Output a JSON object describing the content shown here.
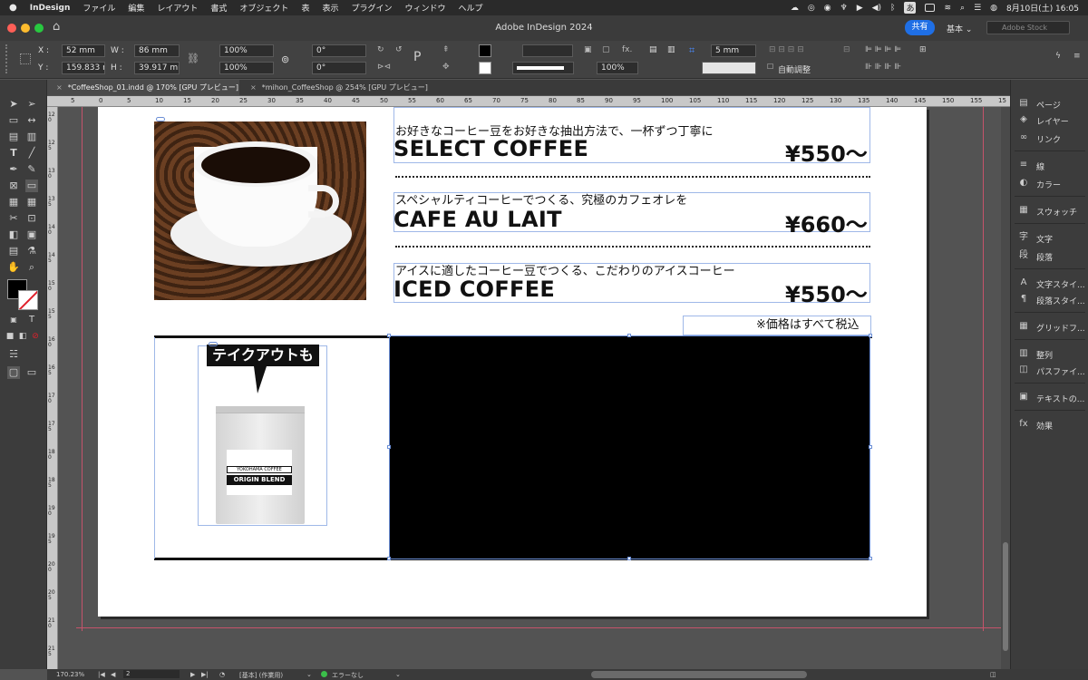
{
  "menubar": {
    "app_name": "InDesign",
    "items": [
      "ファイル",
      "編集",
      "レイアウト",
      "書式",
      "オブジェクト",
      "表",
      "表示",
      "プラグイン",
      "ウィンドウ",
      "ヘルプ"
    ],
    "input_mode": "あ",
    "datetime": "8月10日(土)  16:05"
  },
  "titlebar": {
    "title": "Adobe InDesign 2024",
    "share_label": "共有",
    "workspace": "基本",
    "stock_placeholder": "Adobe Stock"
  },
  "control": {
    "x_label": "X :",
    "x_value": "52 mm",
    "y_label": "Y :",
    "y_value": "159.833 m",
    "w_label": "W :",
    "w_value": "86 mm",
    "h_label": "H :",
    "h_value": "39.917 mm",
    "scale_x": "100%",
    "scale_y": "100%",
    "rotate": "0°",
    "shear": "0°",
    "stroke_weight": "",
    "opacity": "100%",
    "gap": "5 mm",
    "auto_fit_label": "自動調整"
  },
  "tabs": [
    {
      "label": "*CoffeeShop_01.indd @ 170% [GPU プレビュー]",
      "active": true
    },
    {
      "label": "*mihon_CoffeeShop @ 254% [GPU プレビュー]",
      "active": false
    }
  ],
  "ruler": {
    "h_ticks": [
      "5",
      "0",
      "5",
      "10",
      "15",
      "20",
      "25",
      "30",
      "35",
      "40",
      "45",
      "50",
      "55",
      "60",
      "65",
      "70",
      "75",
      "80",
      "85",
      "90",
      "95",
      "100",
      "105",
      "110",
      "115",
      "120",
      "125",
      "130",
      "135",
      "140",
      "145",
      "150",
      "155",
      "15"
    ],
    "v_ticks": [
      "120",
      "125",
      "130",
      "135",
      "140",
      "145",
      "150",
      "155",
      "160",
      "165",
      "170",
      "175",
      "180",
      "185",
      "190",
      "195",
      "200",
      "205",
      "210",
      "215"
    ]
  },
  "menu": {
    "items": [
      {
        "desc": "お好きなコーヒー豆をお好きな抽出方法で、一杯ずつ丁寧に",
        "name": "SELECT COFFEE",
        "price": "¥550〜"
      },
      {
        "desc": "スペシャルティコーヒーでつくる、究極のカフェオレを",
        "name": "CAFE AU LAIT",
        "price": "¥660〜"
      },
      {
        "desc": "アイスに適したコーヒー豆でつくる、こだわりのアイスコーヒー",
        "name": "ICED COFFEE",
        "price": "¥550〜"
      }
    ],
    "tax_note": "※価格はすべて税込",
    "takeout_label": "テイクアウトも",
    "bag_brand": "YOKOHAMA COFFEE",
    "bag_blend": "ORIGIN BLEND"
  },
  "panels": [
    {
      "icon": "pages-icon",
      "glyph": "▤",
      "label": "ページ"
    },
    {
      "icon": "layers-icon",
      "glyph": "◈",
      "label": "レイヤー"
    },
    {
      "icon": "links-icon",
      "glyph": "∞",
      "label": "リンク"
    },
    {
      "icon": "stroke-icon",
      "glyph": "≡",
      "label": "線"
    },
    {
      "icon": "color-icon",
      "glyph": "◐",
      "label": "カラー"
    },
    {
      "icon": "swatches-icon",
      "glyph": "▦",
      "label": "スウォッチ"
    },
    {
      "icon": "character-icon",
      "glyph": "字",
      "label": "文字"
    },
    {
      "icon": "paragraph-icon",
      "glyph": "段",
      "label": "段落"
    },
    {
      "icon": "char-styles-icon",
      "glyph": "A",
      "label": "文字スタイ..."
    },
    {
      "icon": "para-styles-icon",
      "glyph": "¶",
      "label": "段落スタイ..."
    },
    {
      "icon": "grid-format-icon",
      "glyph": "▦",
      "label": "グリッドフ..."
    },
    {
      "icon": "align-icon",
      "glyph": "▥",
      "label": "整列"
    },
    {
      "icon": "pathfinder-icon",
      "glyph": "◫",
      "label": "パスファイ..."
    },
    {
      "icon": "text-wrap-icon",
      "glyph": "▣",
      "label": "テキストの..."
    },
    {
      "icon": "effects-icon",
      "glyph": "fx",
      "label": "効果"
    }
  ],
  "status": {
    "zoom": "170.23%",
    "page": "2",
    "style": "[基本] (作業用)",
    "preflight": "エラーなし"
  },
  "colors": {
    "accent": "#1f6fe5",
    "preflight_ok": "#3bbf4a",
    "bleed": "#c5536b"
  }
}
